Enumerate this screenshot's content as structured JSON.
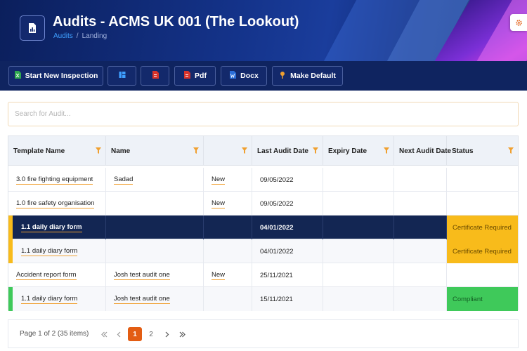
{
  "header": {
    "title": "Audits - ACMS UK 001 (The Lookout)",
    "breadcrumb": {
      "link": "Audits",
      "separator": "/",
      "current": "Landing"
    },
    "icon": "report-chart-icon",
    "settings_icon": "gear-icon"
  },
  "toolbar": {
    "start_label": "Start New Inspection",
    "pdf_label": "Pdf",
    "docx_label": "Docx",
    "default_label": "Make Default",
    "icons": [
      "file-excel-icon",
      "columns-icon",
      "file-pdf-icon",
      "file-pdf-icon",
      "file-word-icon",
      "pin-icon"
    ]
  },
  "search": {
    "placeholder": "Search for Audit...",
    "value": ""
  },
  "table": {
    "columns": [
      "Template Name",
      "Name",
      "",
      "Last Audit Date",
      "Expiry Date",
      "Next Audit Date",
      "Status"
    ],
    "rows": [
      {
        "template": "3.0 fire fighting equipment",
        "name": "Sadad",
        "state": "New",
        "last": "09/05/2022",
        "expiry": "",
        "next": "",
        "status": ""
      },
      {
        "template": "1.0 fire safety organisation",
        "name": "",
        "state": "New",
        "last": "09/05/2022",
        "expiry": "",
        "next": "",
        "status": ""
      },
      {
        "template": "1.1 daily diary form",
        "name": "",
        "state": "",
        "last": "04/01/2022",
        "expiry": "",
        "next": "",
        "status": "Certificate Required"
      },
      {
        "template": "1.1 daily diary form",
        "name": "",
        "state": "",
        "last": "04/01/2022",
        "expiry": "",
        "next": "",
        "status": "Certificate Required"
      },
      {
        "template": "Accident report form",
        "name": "Josh test audit one",
        "state": "New",
        "last": "25/11/2021",
        "expiry": "",
        "next": "",
        "status": ""
      },
      {
        "template": "1.1 daily diary form",
        "name": "Josh test audit one",
        "state": "",
        "last": "15/11/2021",
        "expiry": "",
        "next": "",
        "status": "Compliant"
      }
    ]
  },
  "pager": {
    "info": "Page 1 of 2 (35 items)",
    "pages": [
      "1",
      "2"
    ],
    "current": "1"
  },
  "colors": {
    "accent": "#e35d13",
    "status_certificate_required": "#f8bb1b",
    "status_compliant": "#3fc95a",
    "selected_row": "#132653"
  }
}
